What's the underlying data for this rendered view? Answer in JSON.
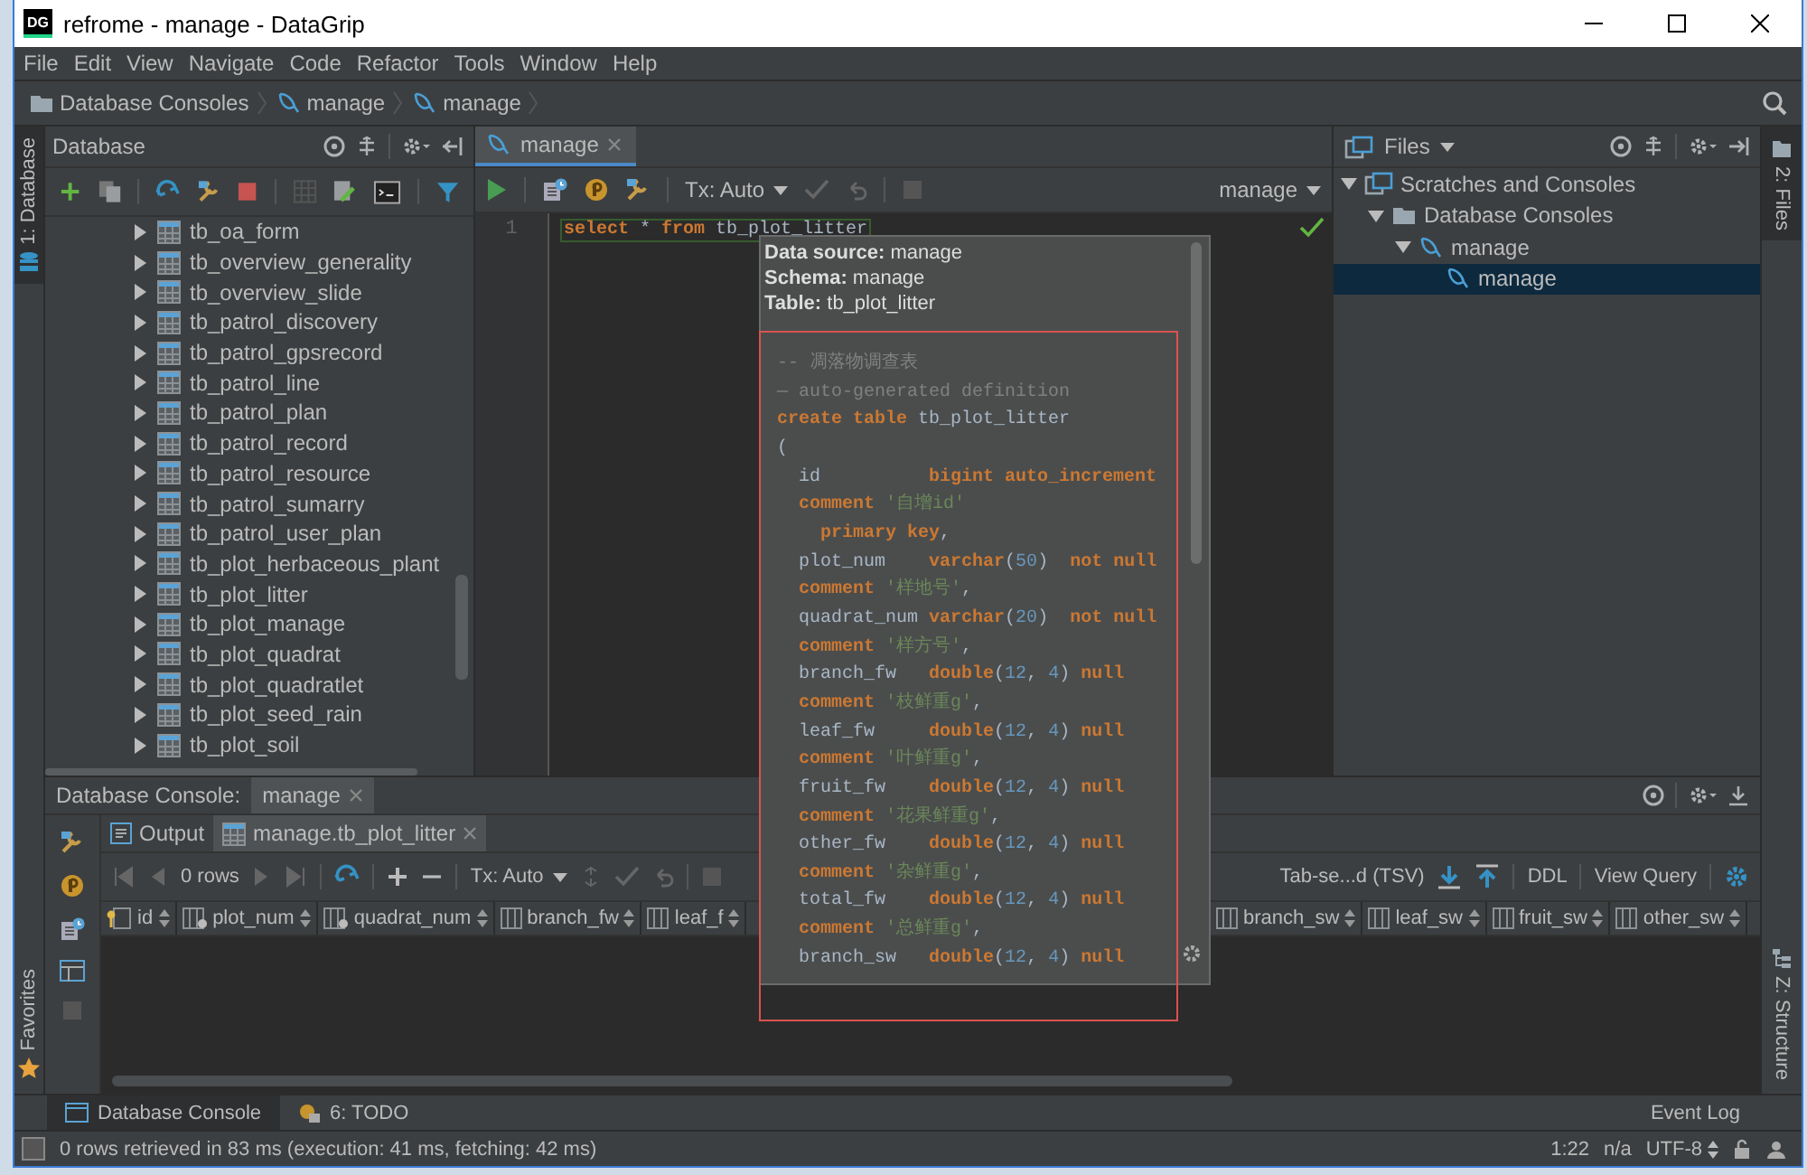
{
  "window": {
    "app_icon": "DG",
    "title": "refrome - manage - DataGrip"
  },
  "menu": [
    "File",
    "Edit",
    "View",
    "Navigate",
    "Code",
    "Refactor",
    "Tools",
    "Window",
    "Help"
  ],
  "breadcrumbs": [
    {
      "label": "Database Consoles",
      "kind": "folder"
    },
    {
      "label": "manage",
      "kind": "console"
    },
    {
      "label": "manage",
      "kind": "console"
    }
  ],
  "left_strip": {
    "top_tab": "1: Database",
    "bottom_tab": "Favorites"
  },
  "database_panel": {
    "title": "Database",
    "tree": [
      {
        "label": "tb_oa_form",
        "expanded": false
      },
      {
        "label": "tb_overview_generality",
        "expanded": false
      },
      {
        "label": "tb_overview_slide",
        "expanded": false
      },
      {
        "label": "tb_patrol_discovery",
        "expanded": false
      },
      {
        "label": "tb_patrol_gpsrecord",
        "expanded": false
      },
      {
        "label": "tb_patrol_line",
        "expanded": false
      },
      {
        "label": "tb_patrol_plan",
        "expanded": false
      },
      {
        "label": "tb_patrol_record",
        "expanded": false
      },
      {
        "label": "tb_patrol_resource",
        "expanded": false
      },
      {
        "label": "tb_patrol_sumarry",
        "expanded": false
      },
      {
        "label": "tb_patrol_user_plan",
        "expanded": false
      },
      {
        "label": "tb_plot_herbaceous_plant",
        "expanded": false
      },
      {
        "label": "tb_plot_litter",
        "expanded": false
      },
      {
        "label": "tb_plot_manage",
        "expanded": false
      },
      {
        "label": "tb_plot_quadrat",
        "expanded": false
      },
      {
        "label": "tb_plot_quadratlet",
        "expanded": false
      },
      {
        "label": "tb_plot_seed_rain",
        "expanded": false
      },
      {
        "label": "tb_plot_soil",
        "expanded": false
      }
    ]
  },
  "editor": {
    "tabs": [
      {
        "label": "manage",
        "selected": true
      }
    ],
    "tx_mode": "Tx: Auto",
    "data_source": "manage",
    "lines": [
      {
        "number": "1",
        "tokens": [
          {
            "kind": "keyword",
            "text": "select"
          },
          {
            "kind": "plain",
            "text": " * "
          },
          {
            "kind": "keyword",
            "text": "from"
          },
          {
            "kind": "plain",
            "text": " tb_plot_litter"
          }
        ]
      }
    ]
  },
  "files_panel": {
    "title": "Files",
    "tree": [
      {
        "label": "Scratches and Consoles",
        "kind": "scratches",
        "expanded": true,
        "selected": false,
        "children": [
          {
            "label": "Database Consoles",
            "kind": "folder",
            "expanded": true,
            "selected": false,
            "children": [
              {
                "label": "manage",
                "kind": "console",
                "expanded": true,
                "selected": false,
                "children": [
                  {
                    "label": "manage",
                    "kind": "console",
                    "selected": true
                  }
                ]
              }
            ]
          }
        ]
      }
    ]
  },
  "right_strip": {
    "top_tab": "2: Files",
    "bottom_tab": "Z: Structure"
  },
  "popup": {
    "header": [
      "**Data source:** manage",
      "**Schema:** manage",
      "**Table:** tb_plot_litter"
    ],
    "lines": [
      [
        {
          "kind": "comment",
          "text": "-- 凋落物调查表"
        }
      ],
      [
        {
          "kind": "comment",
          "text": "— auto-generated definition"
        }
      ],
      [
        {
          "kind": "keyword",
          "text": "create table"
        },
        {
          "kind": "plain",
          "text": " tb_plot_litter"
        }
      ],
      [
        {
          "kind": "plain",
          "text": "("
        }
      ],
      [
        {
          "kind": "plain",
          "text": "  id          "
        },
        {
          "kind": "keyword",
          "text": "bigint auto_increment"
        }
      ],
      [
        {
          "kind": "keyword",
          "text": "  comment"
        },
        {
          "kind": "string",
          "text": " '自增id'"
        }
      ],
      [
        {
          "kind": "keyword",
          "text": "    primary key"
        },
        {
          "kind": "plain",
          "text": ","
        }
      ],
      [
        {
          "kind": "plain",
          "text": "  plot_num    "
        },
        {
          "kind": "keyword",
          "text": "varchar"
        },
        {
          "kind": "plain",
          "text": "("
        },
        {
          "kind": "number",
          "text": "50"
        },
        {
          "kind": "plain",
          "text": ")"
        },
        {
          "kind": "keyword",
          "text": "  not null"
        }
      ],
      [
        {
          "kind": "keyword",
          "text": "  comment"
        },
        {
          "kind": "string",
          "text": " '样地号'"
        },
        {
          "kind": "plain",
          "text": ","
        }
      ],
      [
        {
          "kind": "plain",
          "text": "  quadrat_num "
        },
        {
          "kind": "keyword",
          "text": "varchar"
        },
        {
          "kind": "plain",
          "text": "("
        },
        {
          "kind": "number",
          "text": "20"
        },
        {
          "kind": "plain",
          "text": ")"
        },
        {
          "kind": "keyword",
          "text": "  not null"
        }
      ],
      [
        {
          "kind": "keyword",
          "text": "  comment"
        },
        {
          "kind": "string",
          "text": " '样方号'"
        },
        {
          "kind": "plain",
          "text": ","
        }
      ],
      [
        {
          "kind": "plain",
          "text": "  branch_fw   "
        },
        {
          "kind": "keyword",
          "text": "double"
        },
        {
          "kind": "plain",
          "text": "("
        },
        {
          "kind": "number",
          "text": "12"
        },
        {
          "kind": "plain",
          "text": ", "
        },
        {
          "kind": "number",
          "text": "4"
        },
        {
          "kind": "plain",
          "text": ")"
        },
        {
          "kind": "keyword",
          "text": " null"
        }
      ],
      [
        {
          "kind": "keyword",
          "text": "  comment"
        },
        {
          "kind": "string",
          "text": " '枝鲜重g'"
        },
        {
          "kind": "plain",
          "text": ","
        }
      ],
      [
        {
          "kind": "plain",
          "text": "  leaf_fw     "
        },
        {
          "kind": "keyword",
          "text": "double"
        },
        {
          "kind": "plain",
          "text": "("
        },
        {
          "kind": "number",
          "text": "12"
        },
        {
          "kind": "plain",
          "text": ", "
        },
        {
          "kind": "number",
          "text": "4"
        },
        {
          "kind": "plain",
          "text": ")"
        },
        {
          "kind": "keyword",
          "text": " null"
        }
      ],
      [
        {
          "kind": "keyword",
          "text": "  comment"
        },
        {
          "kind": "string",
          "text": " '叶鲜重g'"
        },
        {
          "kind": "plain",
          "text": ","
        }
      ],
      [
        {
          "kind": "plain",
          "text": "  fruit_fw    "
        },
        {
          "kind": "keyword",
          "text": "double"
        },
        {
          "kind": "plain",
          "text": "("
        },
        {
          "kind": "number",
          "text": "12"
        },
        {
          "kind": "plain",
          "text": ", "
        },
        {
          "kind": "number",
          "text": "4"
        },
        {
          "kind": "plain",
          "text": ")"
        },
        {
          "kind": "keyword",
          "text": " null"
        }
      ],
      [
        {
          "kind": "keyword",
          "text": "  comment"
        },
        {
          "kind": "string",
          "text": " '花果鲜重g'"
        },
        {
          "kind": "plain",
          "text": ","
        }
      ],
      [
        {
          "kind": "plain",
          "text": "  other_fw    "
        },
        {
          "kind": "keyword",
          "text": "double"
        },
        {
          "kind": "plain",
          "text": "("
        },
        {
          "kind": "number",
          "text": "12"
        },
        {
          "kind": "plain",
          "text": ", "
        },
        {
          "kind": "number",
          "text": "4"
        },
        {
          "kind": "plain",
          "text": ")"
        },
        {
          "kind": "keyword",
          "text": " null"
        }
      ],
      [
        {
          "kind": "keyword",
          "text": "  comment"
        },
        {
          "kind": "string",
          "text": " '杂鲜重g'"
        },
        {
          "kind": "plain",
          "text": ","
        }
      ],
      [
        {
          "kind": "plain",
          "text": "  total_fw    "
        },
        {
          "kind": "keyword",
          "text": "double"
        },
        {
          "kind": "plain",
          "text": "("
        },
        {
          "kind": "number",
          "text": "12"
        },
        {
          "kind": "plain",
          "text": ", "
        },
        {
          "kind": "number",
          "text": "4"
        },
        {
          "kind": "plain",
          "text": ")"
        },
        {
          "kind": "keyword",
          "text": " null"
        }
      ],
      [
        {
          "kind": "keyword",
          "text": "  comment"
        },
        {
          "kind": "string",
          "text": " '总鲜重g'"
        },
        {
          "kind": "plain",
          "text": ","
        }
      ],
      [
        {
          "kind": "plain",
          "text": "  branch_sw   "
        },
        {
          "kind": "keyword",
          "text": "double"
        },
        {
          "kind": "plain",
          "text": "("
        },
        {
          "kind": "number",
          "text": "12"
        },
        {
          "kind": "plain",
          "text": ", "
        },
        {
          "kind": "number",
          "text": "4"
        },
        {
          "kind": "plain",
          "text": ")"
        },
        {
          "kind": "keyword",
          "text": " null"
        }
      ]
    ]
  },
  "console": {
    "title": "Database Console:",
    "tabs": [
      {
        "label": "manage",
        "selected": true
      }
    ],
    "result_tabs": [
      {
        "label": "Output",
        "kind": "output",
        "selected": false
      },
      {
        "label": "manage.tb_plot_litter",
        "kind": "table",
        "selected": true
      }
    ],
    "row_count": "0 rows",
    "tx_mode": "Tx: Auto",
    "export_format": "Tab-se...d (TSV)",
    "ddl_button": "DDL",
    "view_query_button": "View Query",
    "columns_left": [
      {
        "name": "id",
        "kind": "key"
      },
      {
        "name": "plot_num",
        "kind": "required"
      },
      {
        "name": "quadrat_num",
        "kind": "required"
      },
      {
        "name": "branch_fw",
        "kind": "column"
      },
      {
        "name": "leaf_f",
        "kind": "column"
      }
    ],
    "columns_right": [
      {
        "name": "branch_sw",
        "kind": "column"
      },
      {
        "name": "leaf_sw",
        "kind": "column"
      },
      {
        "name": "fruit_sw",
        "kind": "column"
      },
      {
        "name": "other_sw",
        "kind": "column"
      }
    ]
  },
  "tool_tabs": [
    {
      "label": "Database Console",
      "kind": "console",
      "selected": true
    },
    {
      "label": "6: TODO",
      "kind": "todo",
      "selected": false
    }
  ],
  "event_log": "Event Log",
  "status_bar": {
    "message": "0 rows retrieved in 83 ms (execution: 41 ms, fetching: 42 ms)",
    "position": "1:22",
    "line_separator": "n/a",
    "encoding": "UTF-8"
  }
}
